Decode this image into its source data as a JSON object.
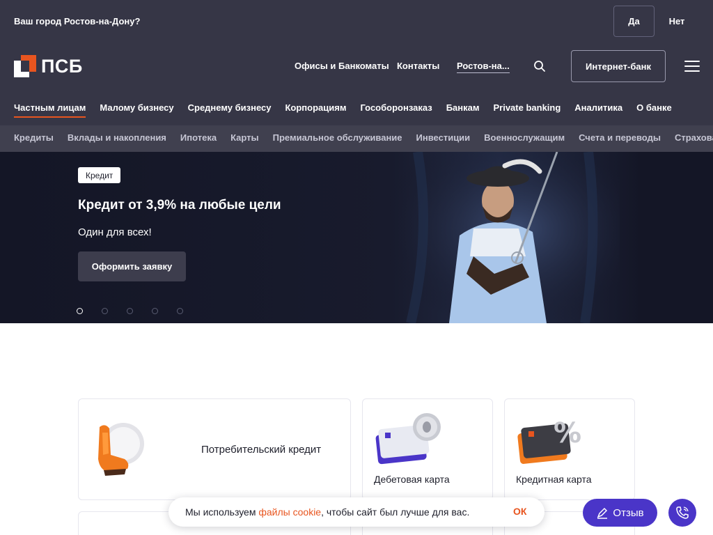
{
  "city_bar": {
    "question": "Ваш город Ростов-на-Дону?",
    "yes": "Да",
    "no": "Нет"
  },
  "header": {
    "logo_text": "ПСБ",
    "nav": [
      "Офисы и Банкоматы",
      "Контакты",
      "Ростов-на..."
    ],
    "internet_bank": "Интернет-банк"
  },
  "segments": [
    "Частным лицам",
    "Малому бизнесу",
    "Среднему бизнесу",
    "Корпорациям",
    "Гособоронзаказ",
    "Банкам",
    "Private banking",
    "Аналитика",
    "О банке"
  ],
  "subnav": [
    "Кредиты",
    "Вклады и накопления",
    "Ипотека",
    "Карты",
    "Премиальное обслуживание",
    "Инвестиции",
    "Военнослужащим",
    "Счета и переводы",
    "Страхование"
  ],
  "hero": {
    "badge": "Кредит",
    "title": "Кредит от 3,9% на любые цели",
    "subtitle": "Один для всех!",
    "button": "Оформить заявку",
    "slides_total": 5,
    "active_slide": 1
  },
  "products": {
    "consumer_credit": "Потребительский кредит",
    "debit_card": "Дебетовая карта",
    "credit_card": "Кредитная карта"
  },
  "cookie": {
    "before": "Мы используем ",
    "link": "файлы cookie",
    "after": ", чтобы сайт был лучше для вас.",
    "ok": "ОК"
  },
  "feedback": "Отзыв",
  "colors": {
    "header_bg": "#363646",
    "accent": "#e8551f",
    "feedback": "#4a35c8"
  }
}
